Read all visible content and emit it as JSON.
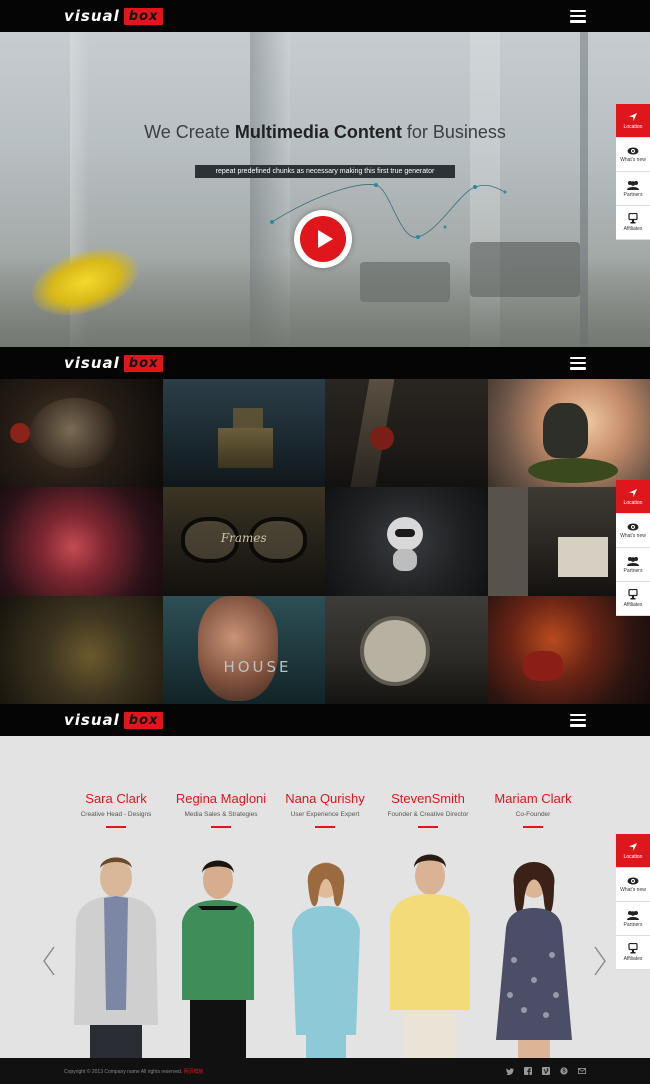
{
  "brand": {
    "word": "visual",
    "box": "box"
  },
  "hero": {
    "title_pre": "We Create",
    "title_bold": "Multimedia Content",
    "title_post": "for Business",
    "subtitle": "repeat predefined chunks as necessary making this first true generator"
  },
  "side_widget": {
    "items": [
      {
        "label": "Location",
        "icon": "location-arrow-icon"
      },
      {
        "label": "What's new",
        "icon": "eye-icon"
      },
      {
        "label": "Partners",
        "icon": "users-icon"
      },
      {
        "label": "Affiliates",
        "icon": "trophy-icon"
      }
    ]
  },
  "gallery": {
    "tile_texts": {
      "frames": "Frames",
      "house": "HOUSE"
    }
  },
  "team": {
    "members": [
      {
        "name": "Sara Clark",
        "role": "Creative Head - Designs"
      },
      {
        "name": "Regina Magloni",
        "role": "Media Sales & Strategies"
      },
      {
        "name": "Nana Qurishy",
        "role": "User Experience Expert"
      },
      {
        "name": "StevenSmith",
        "role": "Founder & Creative Director"
      },
      {
        "name": "Mariam Clark",
        "role": "Co-Founder"
      }
    ]
  },
  "footer": {
    "copyright": "Copyright © 2013 Company name All rights reserved.",
    "link": "网页模板"
  },
  "colors": {
    "accent": "#e0161d",
    "nav": "#050505",
    "team_bg": "#e3e3e3"
  }
}
